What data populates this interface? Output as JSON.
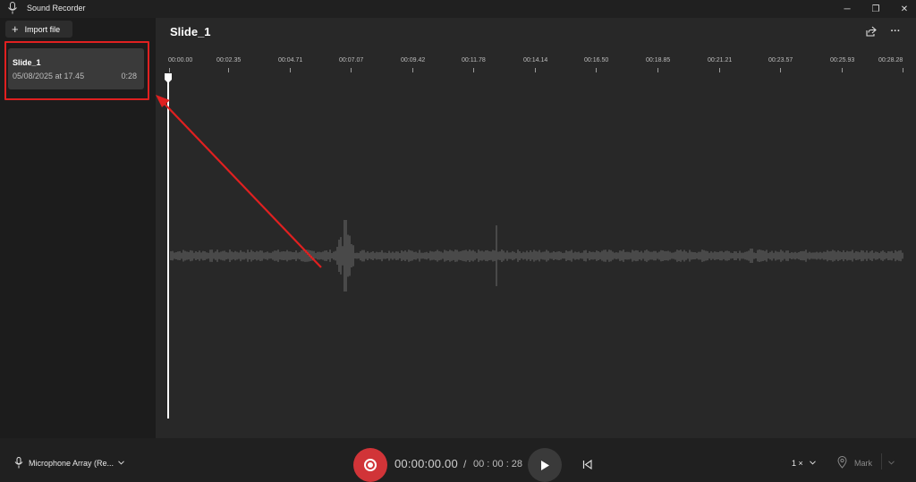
{
  "window": {
    "title": "Sound Recorder",
    "minimize_glyph": "─",
    "restore_glyph": "❐",
    "close_glyph": "✕"
  },
  "sidebar": {
    "import_label": "Import file",
    "recordings": [
      {
        "name": "Slide_1",
        "date": "05/08/2025 at 17.45",
        "duration": "0:28"
      }
    ]
  },
  "main": {
    "title": "Slide_1",
    "more_glyph": "···",
    "timeline_ticks": [
      "00:00.00",
      "00:02.35",
      "00:04.71",
      "00:07.07",
      "00:09.42",
      "00:11.78",
      "00:14.14",
      "00:16.50",
      "00:18.85",
      "00:21.21",
      "00:23.57",
      "00:25.93",
      "00:28.28"
    ]
  },
  "bottom": {
    "microphone": "Microphone Array (Re...",
    "current_time": "00:00:00.00",
    "separator": "/",
    "total_time": "00 : 00 : 28",
    "speed": "1 ×",
    "mark": "Mark"
  },
  "colors": {
    "accent_record": "#d13438",
    "annotation": "#e02020",
    "background": "#202020"
  },
  "icons": [
    "microphone-icon",
    "plus-icon",
    "share-icon",
    "more-icon",
    "record-icon",
    "play-icon",
    "skip-back-icon",
    "mark-pin-icon",
    "chevron-down-icon"
  ]
}
